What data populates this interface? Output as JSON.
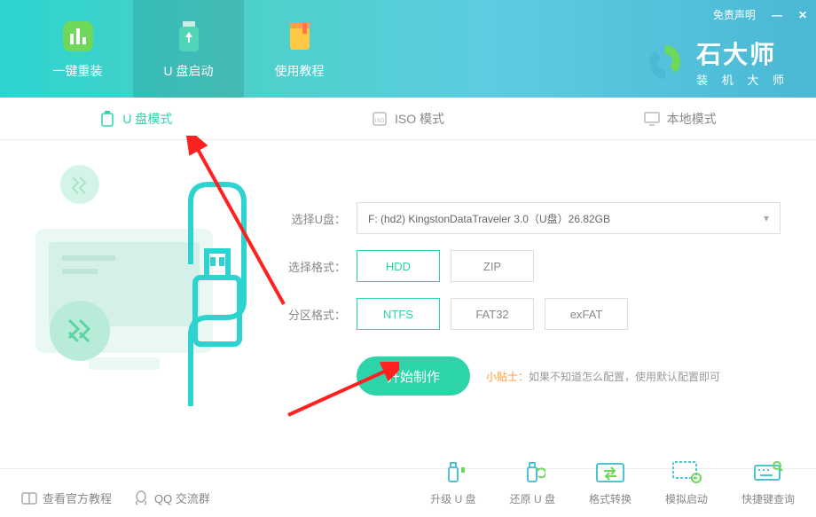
{
  "titlebar": {
    "disclaimer": "免责声明",
    "minimize": "—",
    "close": "✕"
  },
  "nav": {
    "items": [
      {
        "label": "一键重装"
      },
      {
        "label": "U 盘启动"
      },
      {
        "label": "使用教程"
      }
    ]
  },
  "logo": {
    "title": "石大师",
    "subtitle": "装 机 大 师"
  },
  "modes": {
    "items": [
      {
        "label": "U 盘模式"
      },
      {
        "label": "ISO 模式"
      },
      {
        "label": "本地模式"
      }
    ]
  },
  "form": {
    "usb_label": "选择U盘：",
    "usb_value": "F: (hd2) KingstonDataTraveler 3.0（U盘）26.82GB",
    "format_label": "选择格式：",
    "format_options": [
      "HDD",
      "ZIP"
    ],
    "format_selected": "HDD",
    "partition_label": "分区格式：",
    "partition_options": [
      "NTFS",
      "FAT32",
      "exFAT"
    ],
    "partition_selected": "NTFS"
  },
  "action": {
    "start": "开始制作",
    "tip_label": "小贴士：",
    "tip_text": "如果不知道怎么配置，使用默认配置即可"
  },
  "footer": {
    "links": [
      {
        "label": "查看官方教程"
      },
      {
        "label": "QQ 交流群"
      }
    ],
    "tools": [
      {
        "label": "升级 U 盘"
      },
      {
        "label": "还原 U 盘"
      },
      {
        "label": "格式转换"
      },
      {
        "label": "模拟启动"
      },
      {
        "label": "快捷键查询"
      }
    ]
  }
}
